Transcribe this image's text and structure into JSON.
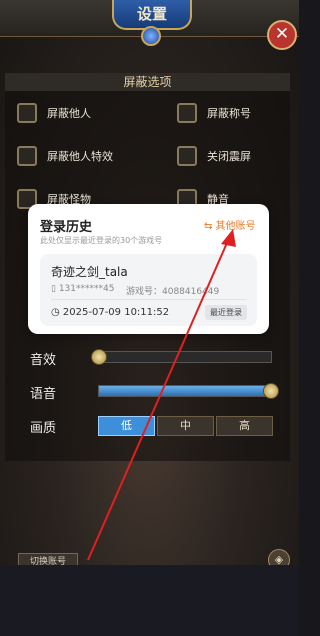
{
  "header": {
    "title": "设置"
  },
  "shield_section": {
    "title": "屏蔽选项",
    "options": [
      {
        "label": "屏蔽他人"
      },
      {
        "label": "屏蔽称号"
      },
      {
        "label": "屏蔽他人特效"
      },
      {
        "label": "关闭震屏"
      },
      {
        "label": "屏蔽怪物"
      },
      {
        "label": "静音"
      }
    ]
  },
  "audio": {
    "sound_label": "音效",
    "sound_level": 0,
    "voice_label": "语音",
    "voice_level": 1.0
  },
  "quality": {
    "label": "画质",
    "options": [
      "低",
      "中",
      "高"
    ],
    "selected": "低"
  },
  "footer": {
    "switch_account": "切换账号"
  },
  "login_popup": {
    "title": "登录历史",
    "subtitle": "此处仅显示最近登录的30个游戏号",
    "other_account": "⇆ 其他账号",
    "record": {
      "name": "奇迹之剑_tala",
      "phone": "131******45",
      "game_id": "游戏号：4088416449",
      "time": "2025-07-09 10:11:52",
      "badge": "最近登录"
    }
  },
  "colors": {
    "accent": "#e87a2a",
    "quality_active": "#3c8fd8",
    "arrow": "#e02020"
  }
}
